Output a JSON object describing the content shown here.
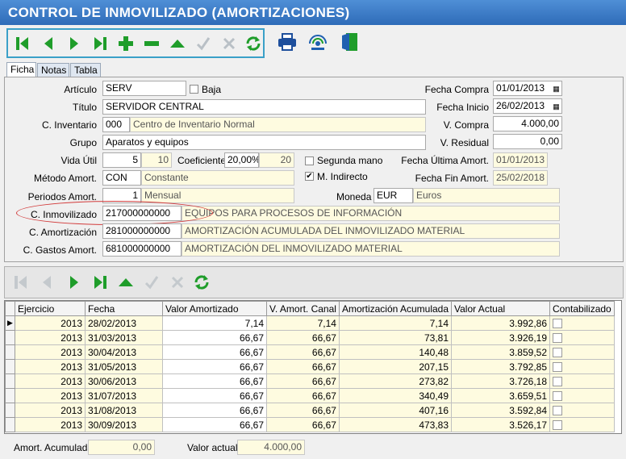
{
  "window": {
    "title": "CONTROL DE INMOVILIZADO (AMORTIZACIONES)"
  },
  "tabs": [
    {
      "label": "Ficha"
    },
    {
      "label": "Notas"
    },
    {
      "label": "Tabla"
    }
  ],
  "form": {
    "articulo": {
      "label": "Artículo",
      "value": "SERV"
    },
    "baja": {
      "label": "Baja"
    },
    "titulo": {
      "label": "Título",
      "value": "SERVIDOR CENTRAL"
    },
    "inventario": {
      "label": "C. Inventario",
      "code": "000",
      "desc": "Centro de Inventario Normal"
    },
    "grupo": {
      "label": "Grupo",
      "value": "Aparatos y equipos"
    },
    "vida_util": {
      "label": "Vida Útil",
      "value": "5",
      "value2": "10"
    },
    "coeficiente": {
      "label": "Coeficiente",
      "value": "20,00%",
      "value2": "20"
    },
    "segunda_mano": {
      "label": "Segunda mano"
    },
    "metodo": {
      "label": "Método Amort.",
      "code": "CON",
      "desc": "Constante"
    },
    "m_indirecto": {
      "label": "M. Indirecto",
      "check": "✔"
    },
    "periodos": {
      "label": "Periodos Amort.",
      "code": "1",
      "desc": "Mensual"
    },
    "moneda": {
      "label": "Moneda",
      "code": "EUR",
      "desc": "Euros"
    },
    "inmovilizado": {
      "label": "C. Inmovilizado",
      "code": "217000000000",
      "desc": "EQUIPOS PARA PROCESOS DE INFORMACIÓN"
    },
    "amortizacion": {
      "label": "C. Amortización",
      "code": "281000000000",
      "desc": "AMORTIZACIÓN ACUMULADA DEL INMOVILIZADO MATERIAL"
    },
    "gastos": {
      "label": "C. Gastos Amort.",
      "code": "681000000000",
      "desc": "AMORTIZACIÓN DEL INMOVILIZADO MATERIAL"
    },
    "fecha_compra": {
      "label": "Fecha Compra",
      "value": "01/01/2013"
    },
    "fecha_inicio": {
      "label": "Fecha Inicio",
      "value": "26/02/2013"
    },
    "v_compra": {
      "label": "V. Compra",
      "value": "4.000,00"
    },
    "v_residual": {
      "label": "V. Residual",
      "value": "0,00"
    },
    "fecha_ultima": {
      "label": "Fecha Última Amort.",
      "value": "01/01/2013"
    },
    "fecha_fin": {
      "label": "Fecha Fin Amort.",
      "value": "25/02/2018"
    }
  },
  "grid": {
    "headers": [
      "Ejercicio",
      "Fecha",
      "Valor Amortizado",
      "V. Amort. Canal",
      "Amortización Acumulada",
      "Valor Actual",
      "Contabilizado"
    ],
    "rows": [
      [
        "2013",
        "28/02/2013",
        "7,14",
        "7,14",
        "7,14",
        "3.992,86"
      ],
      [
        "2013",
        "31/03/2013",
        "66,67",
        "66,67",
        "73,81",
        "3.926,19"
      ],
      [
        "2013",
        "30/04/2013",
        "66,67",
        "66,67",
        "140,48",
        "3.859,52"
      ],
      [
        "2013",
        "31/05/2013",
        "66,67",
        "66,67",
        "207,15",
        "3.792,85"
      ],
      [
        "2013",
        "30/06/2013",
        "66,67",
        "66,67",
        "273,82",
        "3.726,18"
      ],
      [
        "2013",
        "31/07/2013",
        "66,67",
        "66,67",
        "340,49",
        "3.659,51"
      ],
      [
        "2013",
        "31/08/2013",
        "66,67",
        "66,67",
        "407,16",
        "3.592,84"
      ],
      [
        "2013",
        "30/09/2013",
        "66,67",
        "66,67",
        "473,83",
        "3.526,17"
      ]
    ]
  },
  "footer": {
    "acumulada": {
      "label": "Amort. Acumulada",
      "value": "0,00"
    },
    "actual": {
      "label": "Valor actual",
      "value": "4.000,00"
    }
  },
  "colors": {
    "title_bg": "#2e6bb8",
    "green": "#1f9d2a",
    "readonly_bg": "#fefbe0"
  }
}
